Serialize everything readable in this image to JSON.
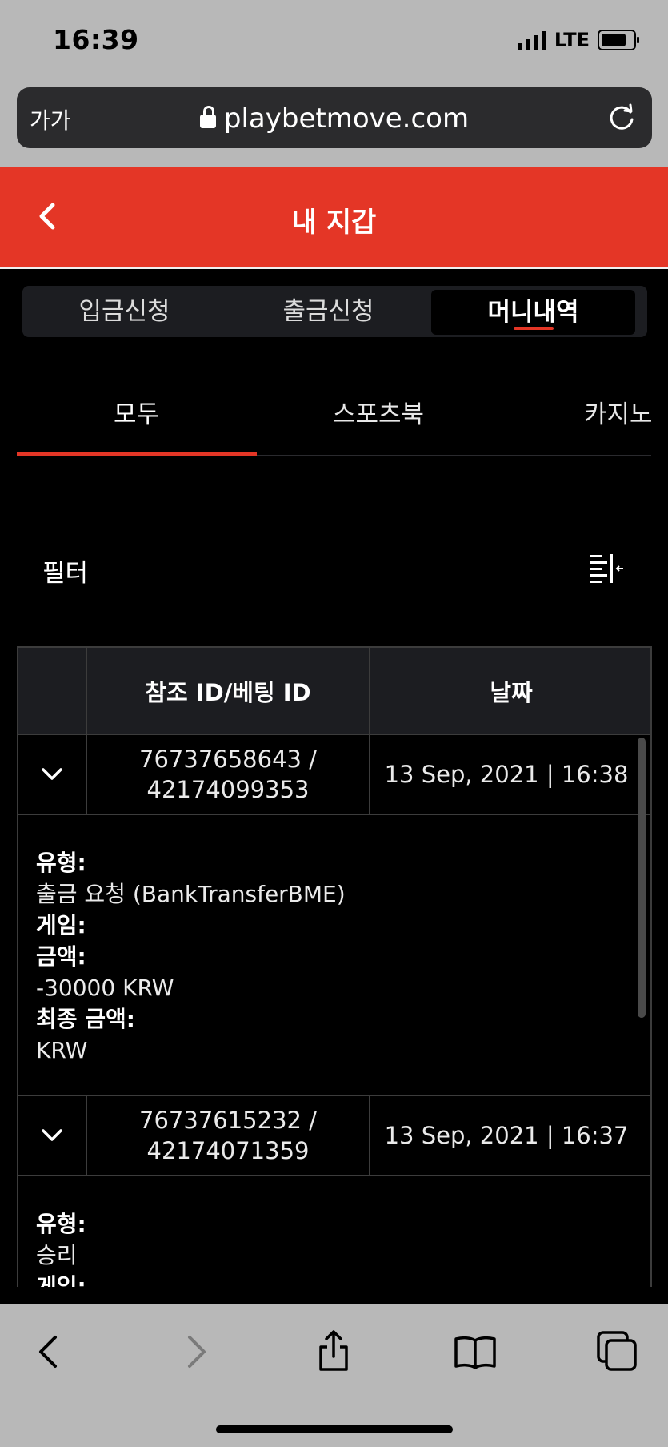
{
  "status_bar": {
    "time": "16:39",
    "network": "LTE"
  },
  "browser": {
    "text_size_label": "가가",
    "url": "playbetmove.com"
  },
  "header": {
    "title": "내 지갑"
  },
  "segments": [
    {
      "label": "입금신청",
      "active": false
    },
    {
      "label": "출금신청",
      "active": false
    },
    {
      "label": "머니내역",
      "active": true
    }
  ],
  "tabs": [
    {
      "label": "모두",
      "active": true
    },
    {
      "label": "스포츠북",
      "active": false
    },
    {
      "label": "카지노",
      "active": false
    }
  ],
  "filter": {
    "label": "필터"
  },
  "table": {
    "columns": [
      "",
      "참조 ID/베팅 ID",
      "날짜"
    ],
    "rows": [
      {
        "ref_id": "76737658643 /",
        "bet_id": "42174099353",
        "date": "13 Sep, 2021 | 16:38",
        "details": {
          "type_label": "유형:",
          "type_value": "출금 요청 (BankTransferBME)",
          "game_label": "게임:",
          "amount_label": "금액:",
          "amount_value": "-30000 KRW",
          "final_label": "최종 금액:",
          "final_value": "KRW"
        }
      },
      {
        "ref_id": "76737615232 /",
        "bet_id": "42174071359",
        "date": "13 Sep, 2021 | 16:37",
        "details": {
          "type_label": "유형:",
          "type_value": "승리",
          "game_label": "게임:"
        }
      }
    ]
  },
  "colors": {
    "accent": "#e43626",
    "chrome": "#b8b8b8",
    "background": "#000000"
  }
}
